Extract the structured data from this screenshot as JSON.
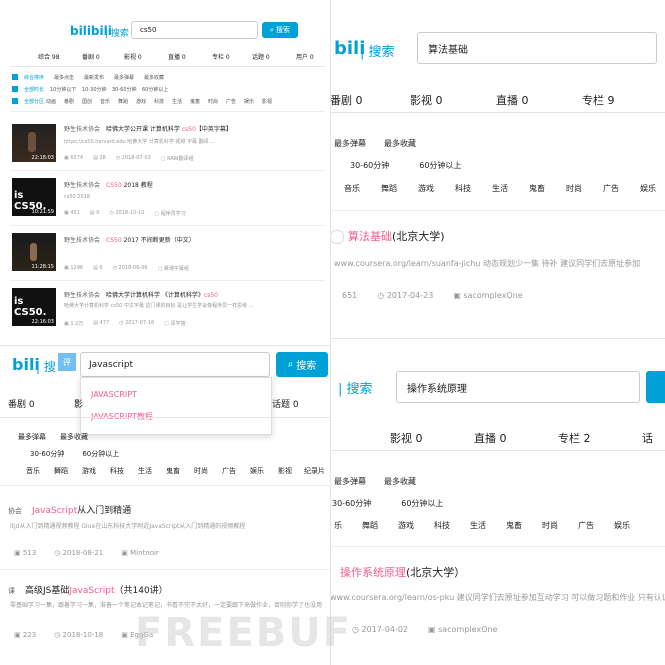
{
  "tl": {
    "logo": "bilibili",
    "logo_sep": "| 搜索",
    "search_value": "cs50",
    "search_button": "搜索",
    "tabs": [
      "综合 98",
      "番剧 0",
      "影视 0",
      "直播 0",
      "专栏 0",
      "话题 0",
      "用户 0"
    ],
    "sort_row": [
      "综合排序",
      "最多点击",
      "最新发布",
      "最多弹幕",
      "最多收藏"
    ],
    "dur_row": [
      "全部时长",
      "10分钟以下",
      "10-30分钟",
      "30-60分钟",
      "60分钟以上"
    ],
    "cat_row": [
      "全部分区",
      "动画",
      "番剧",
      "国创",
      "音乐",
      "舞蹈",
      "游戏",
      "科技",
      "生活",
      "鬼畜",
      "时尚",
      "广告",
      "娱乐",
      "影视"
    ],
    "results": [
      {
        "tag": "野生技术协会",
        "title_pre": "哈佛大学公开课 计算机科学 ",
        "title_hl": "cs50",
        "title_post": "【中英字幕】",
        "desc": "https://cs50.harvard.edu 哈佛大学 计算机科学 视频 字幕 翻译 ...",
        "views": "6574",
        "comments": "28",
        "date": "2018-07-03",
        "up": "RAW翻译组",
        "dur": "22:18:03",
        "thumb_text": ""
      },
      {
        "tag": "野生技术协会",
        "title_pre": "",
        "title_hl": "CS50",
        "title_post": " 2018 教程",
        "desc": "cs50 2018",
        "views": "451",
        "comments": "0",
        "date": "2018-10-10",
        "up": "程序员学习",
        "dur": "10:21:59",
        "thumb_text": "is CS50."
      },
      {
        "tag": "野生技术协会",
        "title_pre": "",
        "title_hl": "CS50",
        "title_post": " 2017 不间断更新（中文）",
        "desc": "",
        "views": "1296",
        "comments": "6",
        "date": "2018-06-06",
        "up": "慕课字幕组",
        "dur": "11:28:15",
        "thumb_text": ""
      },
      {
        "tag": "野生技术协会",
        "title_pre": "哈佛大学计算机科学 《计算机科学》",
        "title_hl": "cs50",
        "title_post": "",
        "desc": "哈佛大学计算机科学 cs50 中文字幕 这门课的目标 是让学生学会像程序员一样思考 ...",
        "views": "1.2万",
        "comments": "477",
        "date": "2017-07-18",
        "up": "译学馆",
        "dur": "22:16:03",
        "thumb_text": "is CS50."
      }
    ]
  },
  "tr": {
    "logo": "bili",
    "logo_sep": "| 搜索",
    "search_value": "算法基础",
    "tabs": [
      "番剧 0",
      "影视 0",
      "直播 0",
      "专栏 9"
    ],
    "sort_row": [
      "最多弹幕",
      "最多收藏"
    ],
    "dur_row": [
      "30-60分钟",
      "60分钟以上"
    ],
    "cat_row": [
      "音乐",
      "舞蹈",
      "游戏",
      "科技",
      "生活",
      "鬼畜",
      "时尚",
      "广告",
      "娱乐"
    ],
    "result": {
      "title_hl": "算法基础",
      "title_post": "(北京大学)",
      "desc": "www.coursera.org/learn/suanfa-jichu 动态规划少一集 待补 建议同学们去原址参加",
      "views": "651",
      "date": "2017-04-23",
      "up": "sacomplexOne"
    }
  },
  "bl": {
    "logo": "bili",
    "logo_sep": "| 搜",
    "badge": "评",
    "search_value": "Javascript",
    "search_button": "搜索",
    "suggestions": [
      "JAVASCRIPT",
      "JAVASCRIPT教程"
    ],
    "tabs": [
      "番剧 0",
      "影",
      "话题 0"
    ],
    "sort_row": [
      "最多弹幕",
      "最多收藏"
    ],
    "dur_row": [
      "30-60分钟",
      "60分钟以上"
    ],
    "cat_row": [
      "音乐",
      "舞蹈",
      "游戏",
      "科技",
      "生活",
      "鬼畜",
      "时尚",
      "广告",
      "娱乐",
      "影视",
      "纪录片"
    ],
    "results": [
      {
        "tag": "协会",
        "title_hl": "JavaScript",
        "title_post": "从入门到精通",
        "desc": "itjd从入门到精通视频教程 Glue在山东科技大学附近JavaScript从入门到精通的视频教程",
        "views": "513",
        "date": "2018-08-21",
        "up": "Mintnoir"
      },
      {
        "tag": "课",
        "title_pre": "高级JS基础",
        "title_hl": "JavaScript",
        "title_post": "（共140讲）",
        "desc": "零基础学习一集，跟着学习一集，准备一个笔记本记笔记，书看不完不太好，一定要跟下来做作业，否则你学了也没用",
        "views": "223",
        "date": "2018-10-18",
        "up": "EggGa"
      }
    ]
  },
  "br": {
    "logo_sep": "| 搜索",
    "search_value": "操作系统原理",
    "tabs": [
      "影视 0",
      "直播 0",
      "专栏 2",
      "话"
    ],
    "sort_row": [
      "最多弹幕",
      "最多收藏"
    ],
    "dur_row": [
      "30-60分钟",
      "60分钟以上"
    ],
    "cat_row": [
      "乐",
      "舞蹈",
      "游戏",
      "科技",
      "生活",
      "鬼畜",
      "时尚",
      "广告",
      "娱乐"
    ],
    "result": {
      "title_hl": "操作系统原理",
      "title_post": "(北京大学）",
      "desc": "www.coursera.org/learn/os-pku 建议同学们去原址参加互动学习 可以做习题和作业 只有认证",
      "date": "2017-04-02",
      "up": "sacomplexOne"
    }
  },
  "watermark": "FREEBUF"
}
